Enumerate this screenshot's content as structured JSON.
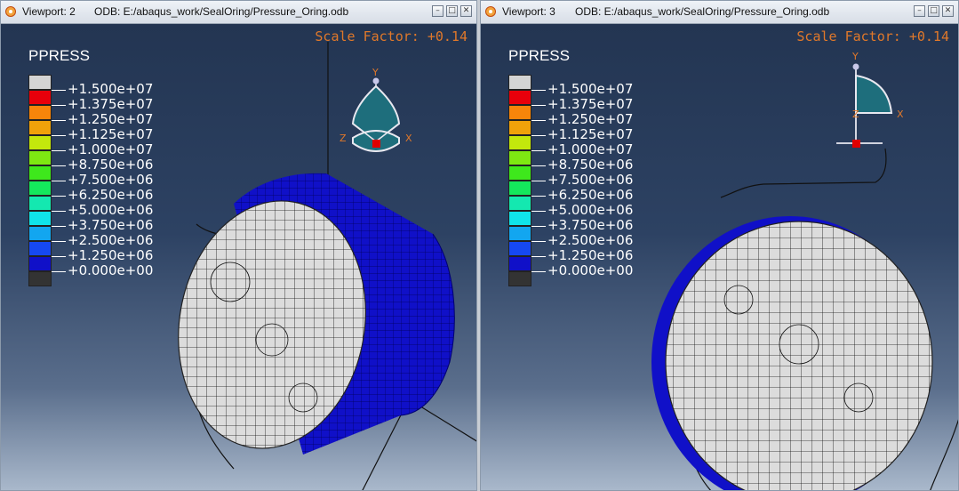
{
  "viewports": [
    {
      "title": "Viewport: 2",
      "odb": "ODB: E:/abaqus_work/SealOring/Pressure_Oring.odb",
      "scale_factor": "Scale Factor: +0.14",
      "legend_title": "PPRESS",
      "triad": {
        "y": "Y",
        "z": "Z",
        "x": "X"
      }
    },
    {
      "title": "Viewport: 3",
      "odb": "ODB: E:/abaqus_work/SealOring/Pressure_Oring.odb",
      "scale_factor": "Scale Factor: +0.14",
      "legend_title": "PPRESS",
      "triad": {
        "y": "Y",
        "z": "Z",
        "x": "X"
      }
    }
  ],
  "legend": {
    "values": [
      "+1.500e+07",
      "+1.375e+07",
      "+1.250e+07",
      "+1.125e+07",
      "+1.000e+07",
      "+8.750e+06",
      "+7.500e+06",
      "+6.250e+06",
      "+5.000e+06",
      "+3.750e+06",
      "+2.500e+06",
      "+1.250e+06",
      "+0.000e+00"
    ],
    "colors": [
      "#d4d4d4",
      "#e8000b",
      "#f7850a",
      "#f0a20a",
      "#c3e80c",
      "#7ee812",
      "#3ee81c",
      "#14e85c",
      "#14e8b0",
      "#10e4ea",
      "#12a6f0",
      "#1648f2",
      "#1010c8",
      "#333333"
    ]
  },
  "window_buttons": [
    "minimize",
    "restore",
    "close"
  ]
}
